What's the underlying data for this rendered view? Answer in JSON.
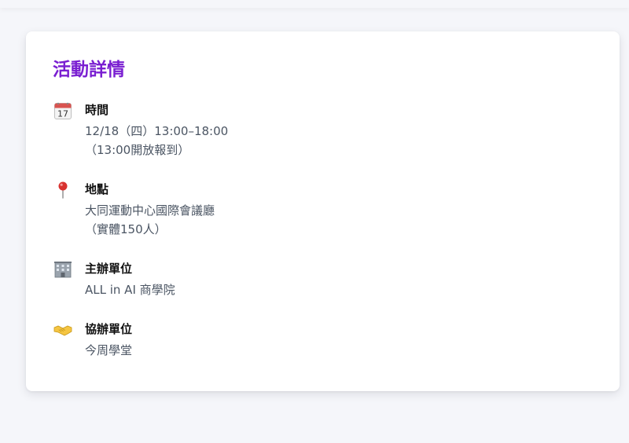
{
  "details": {
    "title": "活動詳情",
    "items": [
      {
        "icon": "calendar-icon",
        "label": "時間",
        "lines": [
          "12/18（四）13:00–18:00",
          "（13:00開放報到）"
        ]
      },
      {
        "icon": "pushpin-icon",
        "label": "地點",
        "lines": [
          "大同運動中心國際會議廳",
          "（實體150人）"
        ]
      },
      {
        "icon": "office-building-icon",
        "label": "主辦單位",
        "lines": [
          "ALL in AI 商學院"
        ]
      },
      {
        "icon": "handshake-icon",
        "label": "協辦單位",
        "lines": [
          "今周學堂"
        ]
      }
    ],
    "calendar_icon_day": "17"
  },
  "colors": {
    "title": "#7a1fd1",
    "label": "#111111",
    "text": "#4b5563",
    "background": "#f5f6fa",
    "card": "#ffffff"
  }
}
